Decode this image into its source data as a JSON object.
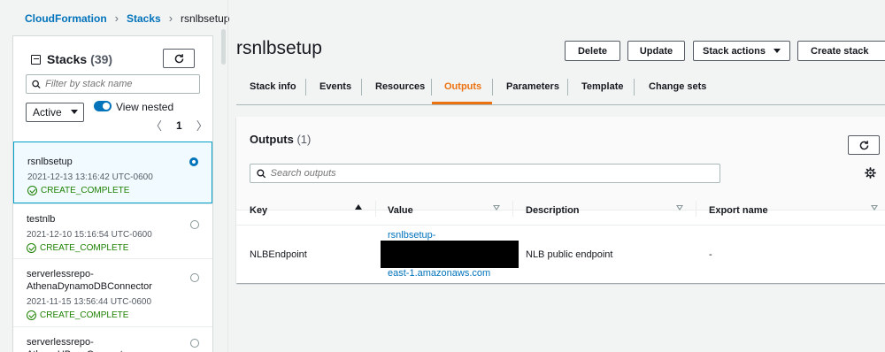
{
  "breadcrumb": {
    "root": "CloudFormation",
    "stacks": "Stacks",
    "current": "rsnlbsetup"
  },
  "sidebar": {
    "title": "Stacks",
    "count": "(39)",
    "filter_placeholder": "Filter by stack name",
    "status_select": "Active",
    "view_nested_label": "View nested",
    "view_nested_on": true,
    "page": "1",
    "stacks": [
      {
        "name": "rsnlbsetup",
        "date": "2021-12-13 13:16:42 UTC-0600",
        "status": "CREATE_COMPLETE",
        "selected": true
      },
      {
        "name": "testnlb",
        "date": "2021-12-10 15:16:54 UTC-0600",
        "status": "CREATE_COMPLETE",
        "selected": false
      },
      {
        "name": "serverlessrepo-AthenaDynamoDBConnector",
        "date": "2021-11-15 13:56:44 UTC-0600",
        "status": "CREATE_COMPLETE",
        "selected": false
      },
      {
        "name": "serverlessrepo-AthenaHBaseConnecto",
        "date": "",
        "status": "",
        "selected": false
      }
    ]
  },
  "main": {
    "title": "rsnlbsetup",
    "buttons": {
      "delete": "Delete",
      "update": "Update",
      "stack_actions": "Stack actions",
      "create_stack": "Create stack"
    },
    "tabs": [
      "Stack info",
      "Events",
      "Resources",
      "Outputs",
      "Parameters",
      "Template",
      "Change sets"
    ],
    "active_tab": "Outputs"
  },
  "outputs": {
    "title": "Outputs",
    "count": "(1)",
    "search_placeholder": "Search outputs",
    "columns": [
      "Key",
      "Value",
      "Description",
      "Export name"
    ],
    "rows": [
      {
        "key": "NLBEndpoint",
        "value_line1": "rsnlbsetup-",
        "value_line3": "east-1.amazonaws.com",
        "description": "NLB public endpoint",
        "export_name": "-"
      }
    ]
  },
  "colors": {
    "accent_orange": "#ec7211",
    "link_blue": "#0073bb",
    "success_green": "#1d8102"
  },
  "icons": [
    "refresh-icon",
    "search-icon",
    "settings-gear-icon",
    "success-check-icon",
    "chevron-left-icon",
    "chevron-right-icon",
    "caret-down-icon",
    "sort-ascending-icon",
    "sort-icon"
  ]
}
